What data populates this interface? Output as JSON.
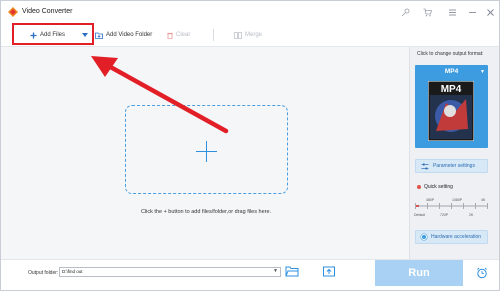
{
  "titlebar": {
    "app_title": "Video Converter"
  },
  "toolbar": {
    "add_files": "Add Files",
    "add_video_folder": "Add Video Folder",
    "clear": "Clear",
    "merge": "Merge"
  },
  "main": {
    "hint": "Click the + button to add files/folder,or drag files here."
  },
  "right_panel": {
    "caption": "Click to change output format:",
    "format": "MP4",
    "format_image_text": "MP4",
    "parameter_settings": "Parameter settings",
    "quick_setting": "Quick setting",
    "quality_top": [
      "480P",
      "1080P",
      "4K"
    ],
    "quality_bottom": [
      "Default",
      "720P",
      "2K"
    ],
    "quality_level": 0,
    "hardware_acceleration": "Hardware acceleration"
  },
  "bottom": {
    "output_folder_label": "Output folder:",
    "output_folder_value": "D:\\find out",
    "run": "Run"
  },
  "colors": {
    "accent": "#3d9be0",
    "highlight": "#e21f26",
    "run_disabled": "#a9d1f3"
  }
}
